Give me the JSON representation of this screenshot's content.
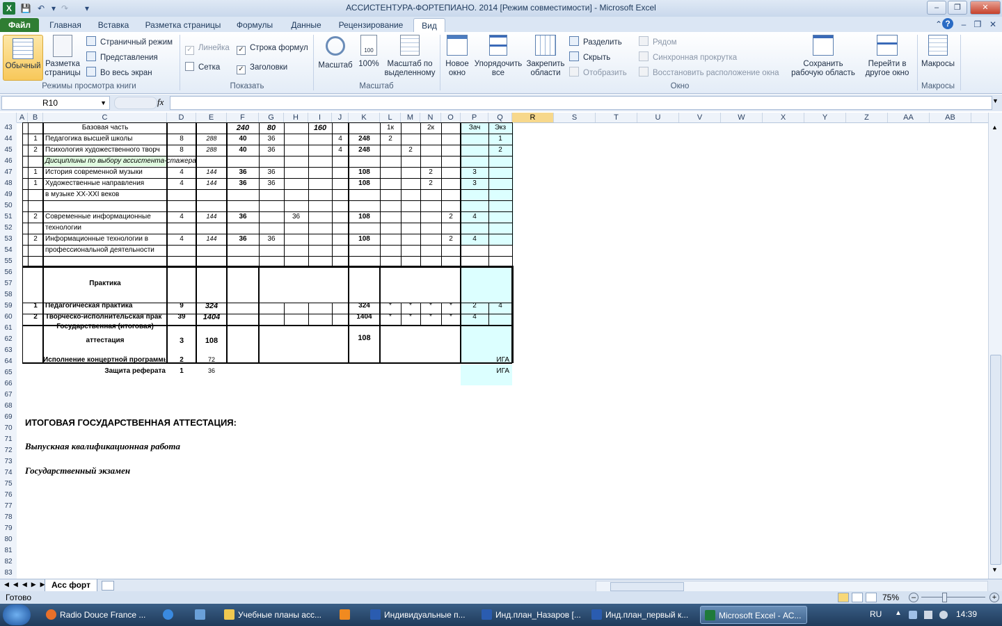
{
  "window": {
    "title": "АССИСТЕНТУРА-ФОРТЕПИАНО. 2014  [Режим совместимости]  -  Microsoft Excel"
  },
  "tabs": [
    "Файл",
    "Главная",
    "Вставка",
    "Разметка страницы",
    "Формулы",
    "Данные",
    "Рецензирование",
    "Вид"
  ],
  "ribbon": {
    "views": {
      "normal": "Обычный",
      "page_layout": "Разметка страницы",
      "page_break": "Страничный режим",
      "custom_views": "Представления",
      "full_screen": "Во весь экран",
      "group": "Режимы просмотра книги"
    },
    "show": {
      "ruler": "Линейка",
      "formula_bar": "Строка формул",
      "gridlines": "Сетка",
      "headings": "Заголовки",
      "group": "Показать"
    },
    "zoom": {
      "zoom": "Масштаб",
      "hundred": "100%",
      "zoom_selection": "Масштаб по выделенному",
      "group": "Масштаб"
    },
    "window": {
      "new_window": "Новое окно",
      "arrange_all": "Упорядочить все",
      "freeze_panes": "Закрепить области",
      "split": "Разделить",
      "hide": "Скрыть",
      "unhide": "Отобразить",
      "side_by_side": "Рядом",
      "sync_scroll": "Синхронная прокрутка",
      "reset_pos": "Восстановить расположение окна",
      "save_workspace": "Сохранить рабочую область",
      "switch_windows": "Перейти в другое окно",
      "group": "Окно"
    },
    "macros": {
      "macros": "Макросы",
      "group": "Макросы"
    }
  },
  "formula_bar": {
    "name_box": "R10",
    "fx": "fx",
    "value": ""
  },
  "columns": [
    "A",
    "B",
    "C",
    "D",
    "E",
    "F",
    "G",
    "H",
    "I",
    "J",
    "K",
    "L",
    "M",
    "N",
    "O",
    "P",
    "Q",
    "R",
    "S",
    "T",
    "U",
    "V",
    "W",
    "X",
    "Y",
    "Z",
    "AA",
    "AB"
  ],
  "rows": [
    {
      "n": "43",
      "B": "",
      "C": "Базовая часть",
      "D": "",
      "E": "",
      "F": "240",
      "G": "80",
      "H": "",
      "I": "160",
      "J": "",
      "K": "",
      "L": "1к",
      "M": "",
      "N": "2к",
      "O": "",
      "P": "Зач",
      "Q": "Экз"
    },
    {
      "n": "44",
      "B": "1",
      "C": "Педагогика высшей школы",
      "D": "8",
      "E": "288",
      "F": "40",
      "G": "36",
      "H": "",
      "I": "",
      "J": "4",
      "K": "248",
      "L": "2",
      "M": "",
      "N": "",
      "O": "",
      "P": "",
      "Q": "1"
    },
    {
      "n": "45",
      "B": "2",
      "C": "Психология художественного творч",
      "D": "8",
      "E": "288",
      "F": "40",
      "G": "36",
      "H": "",
      "I": "",
      "J": "4",
      "K": "248",
      "L": "",
      "M": "2",
      "N": "",
      "O": "",
      "P": "",
      "Q": "2"
    },
    {
      "n": "46",
      "B": "",
      "C": "Дисциплины по выбору ассистента-стажера",
      "D": "",
      "E": "",
      "F": "",
      "G": "",
      "H": "",
      "I": "",
      "J": "",
      "K": "",
      "L": "",
      "M": "",
      "N": "",
      "O": "",
      "P": "",
      "Q": ""
    },
    {
      "n": "47",
      "B": "1",
      "C": "История современной музыки",
      "D": "4",
      "E": "144",
      "F": "36",
      "G": "36",
      "H": "",
      "I": "",
      "J": "",
      "K": "108",
      "L": "",
      "M": "",
      "N": "2",
      "O": "",
      "P": "3",
      "Q": ""
    },
    {
      "n": "48",
      "B": "1",
      "C": "Художественные направления",
      "D": "4",
      "E": "144",
      "F": "36",
      "G": "36",
      "H": "",
      "I": "",
      "J": "",
      "K": "108",
      "L": "",
      "M": "",
      "N": "2",
      "O": "",
      "P": "3",
      "Q": ""
    },
    {
      "n": "49",
      "B": "",
      "C": "в музыке XX-XXI веков",
      "D": "",
      "E": "",
      "F": "",
      "G": "",
      "H": "",
      "I": "",
      "J": "",
      "K": "",
      "L": "",
      "M": "",
      "N": "",
      "O": "",
      "P": "",
      "Q": ""
    },
    {
      "n": "50",
      "B": "",
      "C": "",
      "D": "",
      "E": "",
      "F": "",
      "G": "",
      "H": "",
      "I": "",
      "J": "",
      "K": "",
      "L": "",
      "M": "",
      "N": "",
      "O": "",
      "P": "",
      "Q": ""
    },
    {
      "n": "51",
      "B": "2",
      "C": "Современные информационные",
      "D": "4",
      "E": "144",
      "F": "36",
      "G": "",
      "H": "36",
      "I": "",
      "J": "",
      "K": "108",
      "L": "",
      "M": "",
      "N": "",
      "O": "2",
      "P": "4",
      "Q": ""
    },
    {
      "n": "52",
      "B": "",
      "C": "технологии",
      "D": "",
      "E": "",
      "F": "",
      "G": "",
      "H": "",
      "I": "",
      "J": "",
      "K": "",
      "L": "",
      "M": "",
      "N": "",
      "O": "",
      "P": "",
      "Q": ""
    },
    {
      "n": "53",
      "B": "2",
      "C": "Информационные технологии в",
      "D": "4",
      "E": "144",
      "F": "36",
      "G": "36",
      "H": "",
      "I": "",
      "J": "",
      "K": "108",
      "L": "",
      "M": "",
      "N": "",
      "O": "2",
      "P": "4",
      "Q": ""
    },
    {
      "n": "54",
      "B": "",
      "C": "профессиональной деятельности",
      "D": "",
      "E": "",
      "F": "",
      "G": "",
      "H": "",
      "I": "",
      "J": "",
      "K": "",
      "L": "",
      "M": "",
      "N": "",
      "O": "",
      "P": "",
      "Q": ""
    },
    {
      "n": "55",
      "B": "",
      "C": "",
      "D": "",
      "E": "",
      "F": "",
      "G": "",
      "H": "",
      "I": "",
      "J": "",
      "K": "",
      "L": "",
      "M": "",
      "N": "",
      "O": "",
      "P": "",
      "Q": ""
    }
  ],
  "practice": {
    "label": "Практика",
    "rows": [
      {
        "n": "59",
        "B": "1",
        "C": "Педагогическая практика",
        "D": "9",
        "E": "324",
        "K": "324",
        "L": "*",
        "M": "*",
        "N": "*",
        "O": "*",
        "P": "2",
        "Q": "4"
      },
      {
        "n": "60",
        "B": "2",
        "C": "Творческо-исполнительская прак",
        "D": "39",
        "E": "1404",
        "K": "1404",
        "L": "*",
        "M": "*",
        "N": "*",
        "O": "*",
        "P": "4",
        "Q": ""
      }
    ]
  },
  "attestation": {
    "label1": "Государственная (итоговая)",
    "label2": "аттестация",
    "D": "3",
    "E": "108",
    "K": "108"
  },
  "extra": [
    {
      "n": "64",
      "C": "Исполнение концертной программы",
      "D": "2",
      "E": "72",
      "Q": "ИГА"
    },
    {
      "n": "65",
      "C": "Защита реферата",
      "D": "1",
      "E": "36",
      "Q": "ИГА"
    }
  ],
  "texts": {
    "final_att": "ИТОГОВАЯ  ГОСУДАРСТВЕННАЯ АТТЕСТАЦИЯ:",
    "vkr": "Выпускная квалификационная работа",
    "exam": "Государственный экзамен"
  },
  "row_numbers": [
    "43",
    "44",
    "45",
    "46",
    "47",
    "48",
    "49",
    "50",
    "51",
    "52",
    "53",
    "54",
    "55",
    "56",
    "57",
    "58",
    "59",
    "60",
    "61",
    "62",
    "63",
    "64",
    "65",
    "66",
    "67",
    "68",
    "69",
    "70",
    "71",
    "72",
    "73",
    "74",
    "75",
    "76",
    "77",
    "78",
    "79",
    "80",
    "81",
    "82",
    "83"
  ],
  "sheet": {
    "tab": "Асс форт"
  },
  "status": {
    "ready": "Готово",
    "zoom": "75%"
  },
  "taskbar": {
    "items": [
      "Radio Douce France ...",
      "",
      "",
      "Учебные планы асс...",
      "",
      "Индивидуальные п...",
      "Инд.план_Назаров [...",
      "Инд.план_первый к...",
      "Microsoft Excel - АС..."
    ],
    "lang": "RU",
    "time": "14:39"
  },
  "colors": {
    "accent": "#2f7d32",
    "highlight": "#dcffff",
    "green_cell": "#e1fbe1"
  }
}
